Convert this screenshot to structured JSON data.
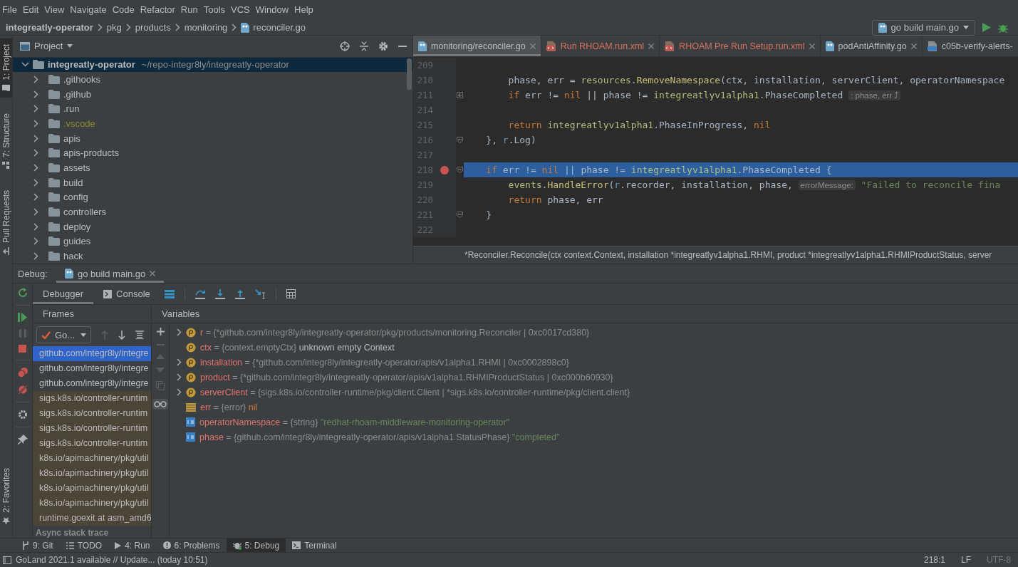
{
  "menu": [
    "File",
    "Edit",
    "View",
    "Navigate",
    "Code",
    "Refactor",
    "Run",
    "Tools",
    "VCS",
    "Window",
    "Help"
  ],
  "breadcrumbs": [
    {
      "label": "integreatly-operator",
      "kind": "project"
    },
    {
      "label": "pkg",
      "kind": "folder"
    },
    {
      "label": "products",
      "kind": "folder"
    },
    {
      "label": "monitoring",
      "kind": "folder"
    },
    {
      "label": "reconciler.go",
      "kind": "file"
    }
  ],
  "run_config": {
    "label": "go build main.go"
  },
  "tool_stripe": {
    "top": [
      {
        "label": "1: Project",
        "kind": "project",
        "selected": true
      },
      {
        "label": "7: Structure",
        "kind": "structure",
        "selected": false
      },
      {
        "label": "Pull Requests",
        "kind": "pull",
        "selected": false
      }
    ],
    "bottom": [
      {
        "label": "2: Favorites",
        "kind": "favorites",
        "selected": false
      }
    ]
  },
  "project": {
    "title": "Project",
    "tree": {
      "name": "integreatly-operator",
      "path": "~/repo-integr8ly/integreatly-operator",
      "expanded": true,
      "selected": true,
      "children": [
        {
          "name": ".githooks",
          "expanded": false,
          "selected": false,
          "ignored": false
        },
        {
          "name": ".github",
          "expanded": false,
          "selected": false,
          "ignored": false
        },
        {
          "name": ".run",
          "expanded": false,
          "selected": false,
          "ignored": false
        },
        {
          "name": ".vscode",
          "expanded": false,
          "selected": false,
          "ignored": true
        },
        {
          "name": "apis",
          "expanded": false,
          "selected": false,
          "ignored": false
        },
        {
          "name": "apis-products",
          "expanded": false,
          "selected": false,
          "ignored": false
        },
        {
          "name": "assets",
          "expanded": false,
          "selected": false,
          "ignored": false
        },
        {
          "name": "build",
          "expanded": false,
          "selected": false,
          "ignored": false
        },
        {
          "name": "config",
          "expanded": false,
          "selected": false,
          "ignored": false
        },
        {
          "name": "controllers",
          "expanded": false,
          "selected": false,
          "ignored": false
        },
        {
          "name": "deploy",
          "expanded": false,
          "selected": false,
          "ignored": false
        },
        {
          "name": "guides",
          "expanded": false,
          "selected": false,
          "ignored": false
        },
        {
          "name": "hack",
          "expanded": false,
          "selected": false,
          "ignored": false
        }
      ]
    }
  },
  "editor": {
    "tabs": [
      {
        "label": "monitoring/reconciler.go",
        "kind": "go",
        "has_errors": false,
        "selected": true
      },
      {
        "label": "Run RHOAM.run.xml",
        "kind": "xml",
        "has_errors": true,
        "selected": false
      },
      {
        "label": "RHOAM Pre Run Setup.run.xml",
        "kind": "xml",
        "has_errors": true,
        "selected": false
      },
      {
        "label": "podAntiAffinity.go",
        "kind": "go",
        "has_errors": false,
        "selected": false
      },
      {
        "label": "c05b-verify-alerts-",
        "kind": "md",
        "has_errors": false,
        "selected": false
      }
    ],
    "lines": [
      {
        "number": "209",
        "breakpoint": false,
        "current": false
      },
      {
        "number": "210",
        "breakpoint": false,
        "current": false,
        "segments": [
          {
            "kind": "plain",
            "text": "        phase, err = "
          },
          {
            "kind": "pkg",
            "text": "resources"
          },
          {
            "kind": "plain",
            "text": "."
          },
          {
            "kind": "func",
            "text": "RemoveNamespace"
          },
          {
            "kind": "plain",
            "text": "(ctx, installation, serverClient, operatorNamespace"
          }
        ]
      },
      {
        "number": "211",
        "breakpoint": false,
        "current": false,
        "foldable": true,
        "folded": true,
        "segments": [
          {
            "kind": "keyword",
            "text": "        if"
          },
          {
            "kind": "plain",
            "text": " err != "
          },
          {
            "kind": "keyword",
            "text": "nil"
          },
          {
            "kind": "plain",
            "text": " || phase != "
          },
          {
            "kind": "pkg",
            "text": "integreatlyv1alpha1"
          },
          {
            "kind": "plain",
            "text": ".PhaseCompleted "
          },
          {
            "kind": "hint",
            "text": ": phase, err ⤴"
          }
        ]
      },
      {
        "number": "214",
        "breakpoint": false,
        "current": false
      },
      {
        "number": "215",
        "breakpoint": false,
        "current": false,
        "segments": [
          {
            "kind": "keyword",
            "text": "        return"
          },
          {
            "kind": "pkg",
            "text": " integreatlyv1alpha1"
          },
          {
            "kind": "plain",
            "text": ".PhaseInProgress, "
          },
          {
            "kind": "keyword",
            "text": "nil"
          }
        ]
      },
      {
        "number": "216",
        "breakpoint": false,
        "current": false,
        "foldable": true,
        "folded": false,
        "segments": [
          {
            "kind": "plain",
            "text": "    }, "
          },
          {
            "kind": "receiver",
            "text": "r"
          },
          {
            "kind": "plain",
            "text": ".Log)"
          }
        ]
      },
      {
        "number": "217",
        "breakpoint": false,
        "current": false
      },
      {
        "number": "218",
        "breakpoint": true,
        "current": true,
        "foldable": true,
        "folded": false,
        "segments": [
          {
            "kind": "keyword",
            "text": "    if"
          },
          {
            "kind": "plain",
            "text": " err != "
          },
          {
            "kind": "keyword",
            "text": "nil"
          },
          {
            "kind": "plain",
            "text": " || phase != "
          },
          {
            "kind": "pkg",
            "text": "integreatlyv1alpha1"
          },
          {
            "kind": "plain",
            "text": ".PhaseCompleted {"
          }
        ]
      },
      {
        "number": "219",
        "breakpoint": false,
        "current": false,
        "segments": [
          {
            "kind": "pkg",
            "text": "        events"
          },
          {
            "kind": "plain",
            "text": "."
          },
          {
            "kind": "func",
            "text": "HandleError"
          },
          {
            "kind": "plain",
            "text": "("
          },
          {
            "kind": "receiver",
            "text": "r"
          },
          {
            "kind": "plain",
            "text": ".recorder, installation, phase, "
          },
          {
            "kind": "hint",
            "text": "errorMessage:"
          },
          {
            "kind": "string",
            "text": " \"Failed to reconcile fina"
          }
        ]
      },
      {
        "number": "220",
        "breakpoint": false,
        "current": false,
        "segments": [
          {
            "kind": "keyword",
            "text": "        return"
          },
          {
            "kind": "plain",
            "text": " phase, err"
          }
        ]
      },
      {
        "number": "221",
        "breakpoint": false,
        "current": false,
        "foldable": true,
        "folded": false,
        "segments": [
          {
            "kind": "plain",
            "text": "    }"
          }
        ]
      },
      {
        "number": "222",
        "breakpoint": false,
        "current": false
      }
    ],
    "signature": "*Reconciler.Reconcile(ctx context.Context, installation *integreatlyv1alpha1.RHMI, product *integreatlyv1alpha1.RHMIProductStatus, server"
  },
  "debug": {
    "title": "Debug:",
    "session": "go build main.go",
    "tabs": [
      {
        "label": "Debugger",
        "kind": "debugger",
        "selected": true
      },
      {
        "label": "Console",
        "kind": "console",
        "selected": false
      }
    ],
    "frames_title": "Frames",
    "thread": "Go...",
    "frames": [
      {
        "label": "github.com/integr8ly/integre",
        "library": false,
        "selected": true
      },
      {
        "label": "github.com/integr8ly/integre",
        "library": false,
        "selected": false
      },
      {
        "label": "github.com/integr8ly/integre",
        "library": false,
        "selected": false
      },
      {
        "label": "sigs.k8s.io/controller-runtim",
        "library": true,
        "selected": false
      },
      {
        "label": "sigs.k8s.io/controller-runtim",
        "library": true,
        "selected": false
      },
      {
        "label": "sigs.k8s.io/controller-runtim",
        "library": true,
        "selected": false
      },
      {
        "label": "sigs.k8s.io/controller-runtim",
        "library": true,
        "selected": false
      },
      {
        "label": "k8s.io/apimachinery/pkg/util",
        "library": true,
        "selected": false
      },
      {
        "label": "k8s.io/apimachinery/pkg/util",
        "library": true,
        "selected": false
      },
      {
        "label": "k8s.io/apimachinery/pkg/util",
        "library": true,
        "selected": false
      },
      {
        "label": "k8s.io/apimachinery/pkg/util",
        "library": true,
        "selected": false
      },
      {
        "label": "runtime.goexit at asm_amd6",
        "library": true,
        "selected": false
      }
    ],
    "async_label": "Async stack trace",
    "variables_title": "Variables",
    "variables": [
      {
        "name": "r",
        "kind": "param",
        "expandable": true,
        "type": "= {*github.com/integr8ly/integreatly-operator/pkg/products/monitoring.Reconciler | 0xc0017cd380}"
      },
      {
        "name": "ctx",
        "kind": "param",
        "expandable": false,
        "type": "= {context.emptyCtx}",
        "value": {
          "text": "unknown empty Context",
          "kind": "plain"
        }
      },
      {
        "name": "installation",
        "kind": "param",
        "expandable": true,
        "type": "= {*github.com/integr8ly/integreatly-operator/apis/v1alpha1.RHMI | 0xc0002898c0}"
      },
      {
        "name": "product",
        "kind": "param",
        "expandable": true,
        "type": "= {*github.com/integr8ly/integreatly-operator/apis/v1alpha1.RHMIProductStatus | 0xc000b60930}"
      },
      {
        "name": "serverClient",
        "kind": "param",
        "expandable": true,
        "type": "= {sigs.k8s.io/controller-runtime/pkg/client.Client | *sigs.k8s.io/controller-runtime/pkg/client.client}"
      },
      {
        "name": "err",
        "kind": "error",
        "expandable": false,
        "type": "= {error}",
        "value": {
          "text": "nil",
          "kind": "keyword"
        }
      },
      {
        "name": "operatorNamespace",
        "kind": "string",
        "expandable": false,
        "type": "= {string}",
        "value": {
          "text": "\"redhat-rhoam-middleware-monitoring-operator\"",
          "kind": "string"
        }
      },
      {
        "name": "phase",
        "kind": "string",
        "expandable": false,
        "type": "= {github.com/integr8ly/integreatly-operator/apis/v1alpha1.StatusPhase}",
        "value": {
          "text": "\"completed\"",
          "kind": "string"
        }
      }
    ]
  },
  "bottom_tools": [
    {
      "label": "9: Git",
      "kind": "git",
      "selected": false
    },
    {
      "label": "TODO",
      "kind": "todo",
      "selected": false
    },
    {
      "label": "4: Run",
      "kind": "run",
      "selected": false
    },
    {
      "label": "6: Problems",
      "kind": "problems",
      "selected": false
    },
    {
      "label": "5: Debug",
      "kind": "debug",
      "selected": true
    },
    {
      "label": "Terminal",
      "kind": "terminal",
      "selected": false
    }
  ],
  "status": {
    "message": "GoLand 2021.1 available // Update... (today 10:51)",
    "position": "218:1",
    "line_ending": "LF",
    "encoding": "UTF-8"
  }
}
